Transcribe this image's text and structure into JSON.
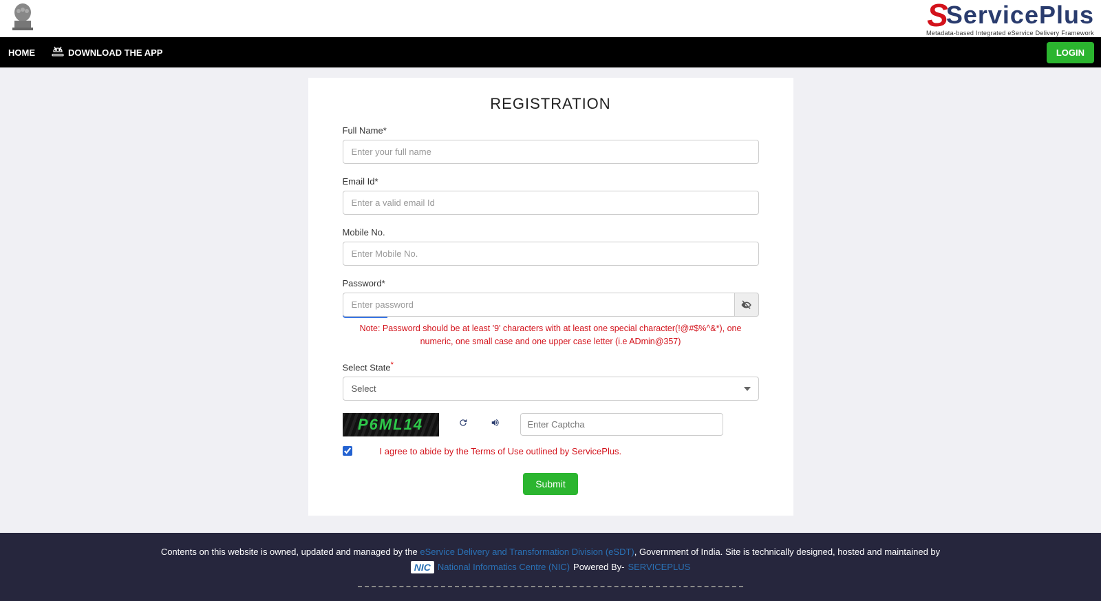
{
  "header": {
    "brand_name": "ServicePlus",
    "brand_tagline": "Metadata-based Integrated eService Delivery Framework"
  },
  "nav": {
    "home": "HOME",
    "download": "DOWNLOAD THE APP",
    "login": "LOGIN"
  },
  "form": {
    "title": "REGISTRATION",
    "fullname_label": "Full Name*",
    "fullname_placeholder": "Enter your full name",
    "email_label": "Email Id*",
    "email_placeholder": "Enter a valid email Id",
    "mobile_label": "Mobile No.",
    "mobile_placeholder": "Enter Mobile No.",
    "password_label": "Password*",
    "password_placeholder": "Enter password",
    "password_note": "Note: Password should be at least '9' characters with at least one special character(!@#$%^&*), one numeric, one small case and one upper case letter (i.e ADmin@357)",
    "state_label": "Select State",
    "state_selected": "Select",
    "captcha_value": "P6ML14",
    "captcha_placeholder": "Enter Captcha",
    "terms_text": "I agree to abide by the Terms of Use outlined by ServicePlus.",
    "submit": "Submit"
  },
  "footer": {
    "line1_prefix": "Contents on this website is owned, updated and managed by the ",
    "line1_link": "eService Delivery and Transformation Division (eSDT)",
    "line1_suffix": ", Government of India. Site is technically designed, hosted and maintained by",
    "nic_badge": "NIC",
    "nic_link": "National Informatics Centre (NIC)",
    "powered_text": " Powered By- ",
    "sp_link": "SERVICEPLUS"
  }
}
